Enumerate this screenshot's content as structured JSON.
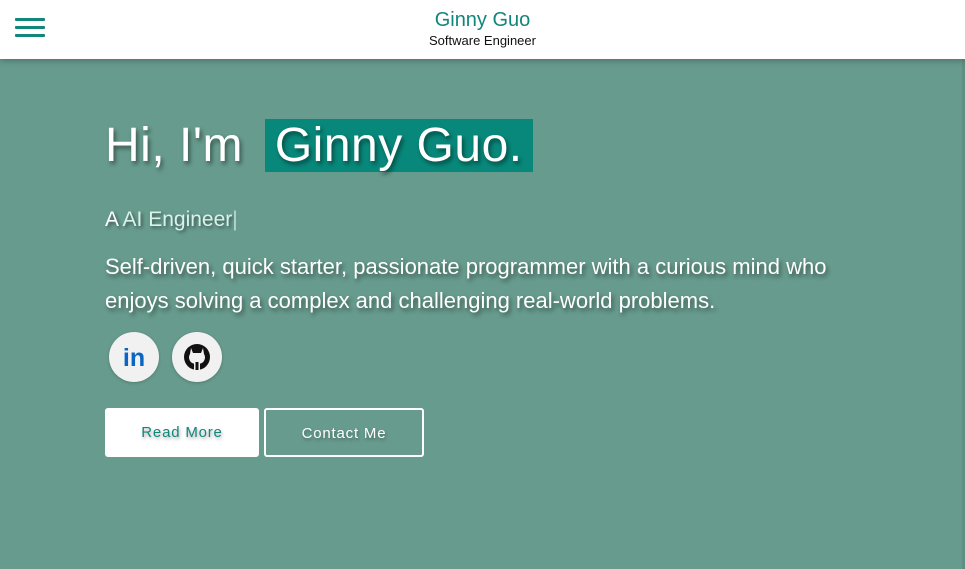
{
  "header": {
    "brand_name": "Ginny Guo",
    "brand_role": "Software Engineer",
    "menu_icon": "hamburger-menu-icon"
  },
  "hero": {
    "greeting_prefix": "Hi, I'm",
    "greeting_name": "Ginny Guo.",
    "typed_prefix": "A",
    "typed_role": "AI Engineer",
    "typed_cursor": "|",
    "tagline": "Self-driven, quick starter, passionate programmer with a curious mind who enjoys solving a complex and challenging real-world problems."
  },
  "socials": [
    {
      "name": "LinkedIn",
      "icon": "linkedin-icon",
      "glyph": "in"
    },
    {
      "name": "GitHub",
      "icon": "github-icon"
    }
  ],
  "buttons": {
    "read_more": "Read More",
    "contact_me": "Contact Me"
  },
  "colors": {
    "accent": "#12867a",
    "hero_background": "#679b8d",
    "name_highlight": "#08887a",
    "linkedin_blue": "#0a66c2"
  }
}
